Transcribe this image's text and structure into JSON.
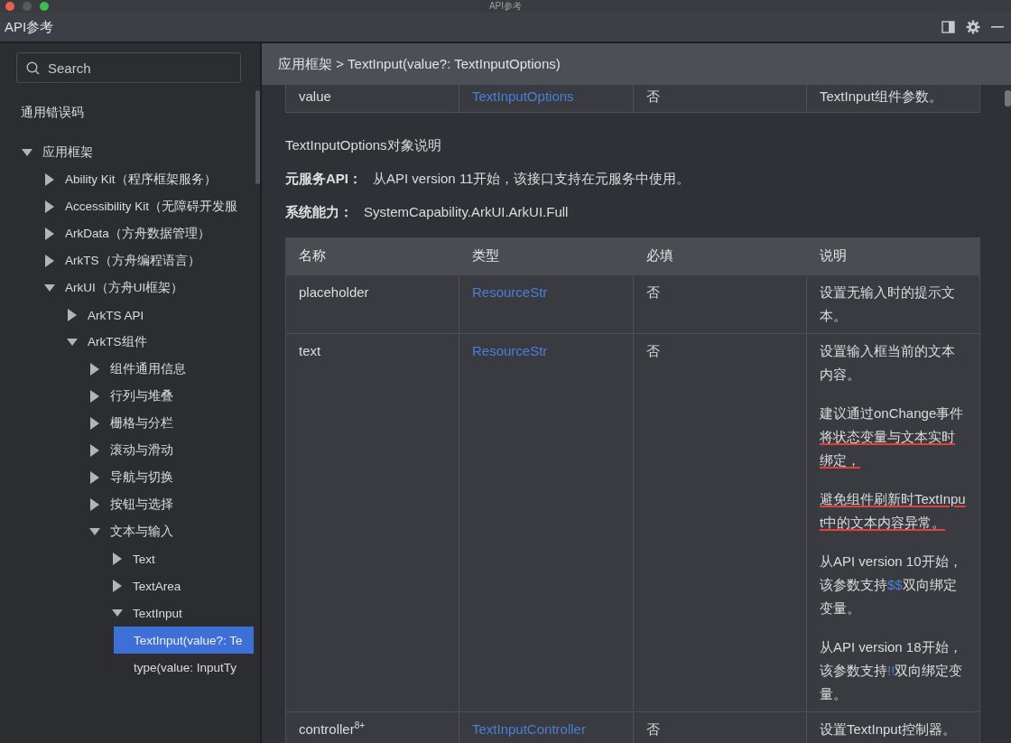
{
  "window": {
    "title": "API参考"
  },
  "panel": {
    "title": "API参考"
  },
  "sidebar": {
    "search": {
      "placeholder": "Search"
    },
    "tree": [
      {
        "label": "通用错误码",
        "kind": "leaf",
        "selected": false
      },
      {
        "label": "应用框架",
        "kind": "folder",
        "expanded": true,
        "selected": false,
        "children": [
          {
            "label": "Ability Kit（程序框架服务）",
            "kind": "folder",
            "expanded": false,
            "selected": false
          },
          {
            "label": "Accessibility Kit（无障碍开发服",
            "kind": "folder",
            "expanded": false,
            "selected": false
          },
          {
            "label": "ArkData（方舟数据管理）",
            "kind": "folder",
            "expanded": false,
            "selected": false
          },
          {
            "label": "ArkTS（方舟编程语言）",
            "kind": "folder",
            "expanded": false,
            "selected": false
          },
          {
            "label": "ArkUI（方舟UI框架）",
            "kind": "folder",
            "expanded": true,
            "selected": false,
            "children": [
              {
                "label": "ArkTS API",
                "kind": "folder",
                "expanded": false,
                "selected": false
              },
              {
                "label": "ArkTS组件",
                "kind": "folder",
                "expanded": true,
                "selected": false,
                "children": [
                  {
                    "label": "组件通用信息",
                    "kind": "folder",
                    "expanded": false,
                    "selected": false
                  },
                  {
                    "label": "行列与堆叠",
                    "kind": "folder",
                    "expanded": false,
                    "selected": false
                  },
                  {
                    "label": "栅格与分栏",
                    "kind": "folder",
                    "expanded": false,
                    "selected": false
                  },
                  {
                    "label": "滚动与滑动",
                    "kind": "folder",
                    "expanded": false,
                    "selected": false
                  },
                  {
                    "label": "导航与切换",
                    "kind": "folder",
                    "expanded": false,
                    "selected": false
                  },
                  {
                    "label": "按钮与选择",
                    "kind": "folder",
                    "expanded": false,
                    "selected": false
                  },
                  {
                    "label": "文本与输入",
                    "kind": "folder",
                    "expanded": true,
                    "selected": false,
                    "children": [
                      {
                        "label": "Text",
                        "kind": "folder",
                        "expanded": false,
                        "selected": false
                      },
                      {
                        "label": "TextArea",
                        "kind": "folder",
                        "expanded": false,
                        "selected": false
                      },
                      {
                        "label": "TextInput",
                        "kind": "folder",
                        "expanded": true,
                        "selected": false,
                        "children": [
                          {
                            "label": "TextInput(value?: Te",
                            "kind": "leaf",
                            "selected": true
                          },
                          {
                            "label": "type(value: InputTy",
                            "kind": "leaf",
                            "selected": false
                          }
                        ]
                      }
                    ]
                  }
                ]
              }
            ]
          }
        ]
      }
    ]
  },
  "content": {
    "breadcrumb": "应用框架 > TextInput(value?: TextInputOptions)",
    "top_table": {
      "rows": [
        {
          "name": "value",
          "type": "TextInputOptions",
          "required": "否",
          "description": [
            {
              "parts": [
                {
                  "text": "TextInput组件参数。",
                  "kind": "text",
                  "underlined": false
                }
              ]
            }
          ]
        }
      ]
    },
    "section_title": "TextInputOptions对象说明",
    "meta": [
      {
        "label": "元服务API：",
        "value": "从API version 11开始，该接口支持在元服务中使用。"
      },
      {
        "label": "系统能力：",
        "value": "SystemCapability.ArkUI.ArkUI.Full"
      }
    ],
    "table": {
      "columns": [
        "名称",
        "类型",
        "必填",
        "说明"
      ],
      "rows": [
        {
          "name": "placeholder",
          "type": "ResourceStr",
          "required": "否",
          "description": [
            {
              "parts": [
                {
                  "text": "设置无输入时的提示文本。",
                  "kind": "text",
                  "underlined": false
                }
              ]
            }
          ]
        },
        {
          "name": "text",
          "type": "ResourceStr",
          "required": "否",
          "description": [
            {
              "parts": [
                {
                  "text": "设置输入框当前的文本内容。",
                  "kind": "text",
                  "underlined": false
                }
              ]
            },
            {
              "parts": [
                {
                  "text": "建议通过onChange事件",
                  "kind": "text",
                  "underlined": false
                },
                {
                  "text": "将状态变量与文本实时绑定，",
                  "kind": "text",
                  "underlined": true
                }
              ]
            },
            {
              "parts": [
                {
                  "text": "避免组件刷新时TextInput中的文本内容异常。",
                  "kind": "text",
                  "underlined": true
                }
              ]
            },
            {
              "parts": [
                {
                  "text": "从API version 10开始，该参数支持",
                  "kind": "text",
                  "underlined": false
                },
                {
                  "text": "$$",
                  "kind": "code",
                  "underlined": false
                },
                {
                  "text": "双向绑定变量。",
                  "kind": "text",
                  "underlined": false
                }
              ]
            },
            {
              "parts": [
                {
                  "text": "从API version 18开始，该参数支持",
                  "kind": "text",
                  "underlined": false
                },
                {
                  "text": "!!",
                  "kind": "code",
                  "underlined": false
                },
                {
                  "text": "双向绑定变量。",
                  "kind": "text",
                  "underlined": false
                }
              ]
            }
          ]
        },
        {
          "name": "controller$^{8+}$",
          "type": "TextInputController",
          "required": "否",
          "description": [
            {
              "parts": [
                {
                  "text": "设置TextInput控制器。",
                  "kind": "text",
                  "underlined": false
                }
              ]
            }
          ]
        }
      ]
    }
  }
}
